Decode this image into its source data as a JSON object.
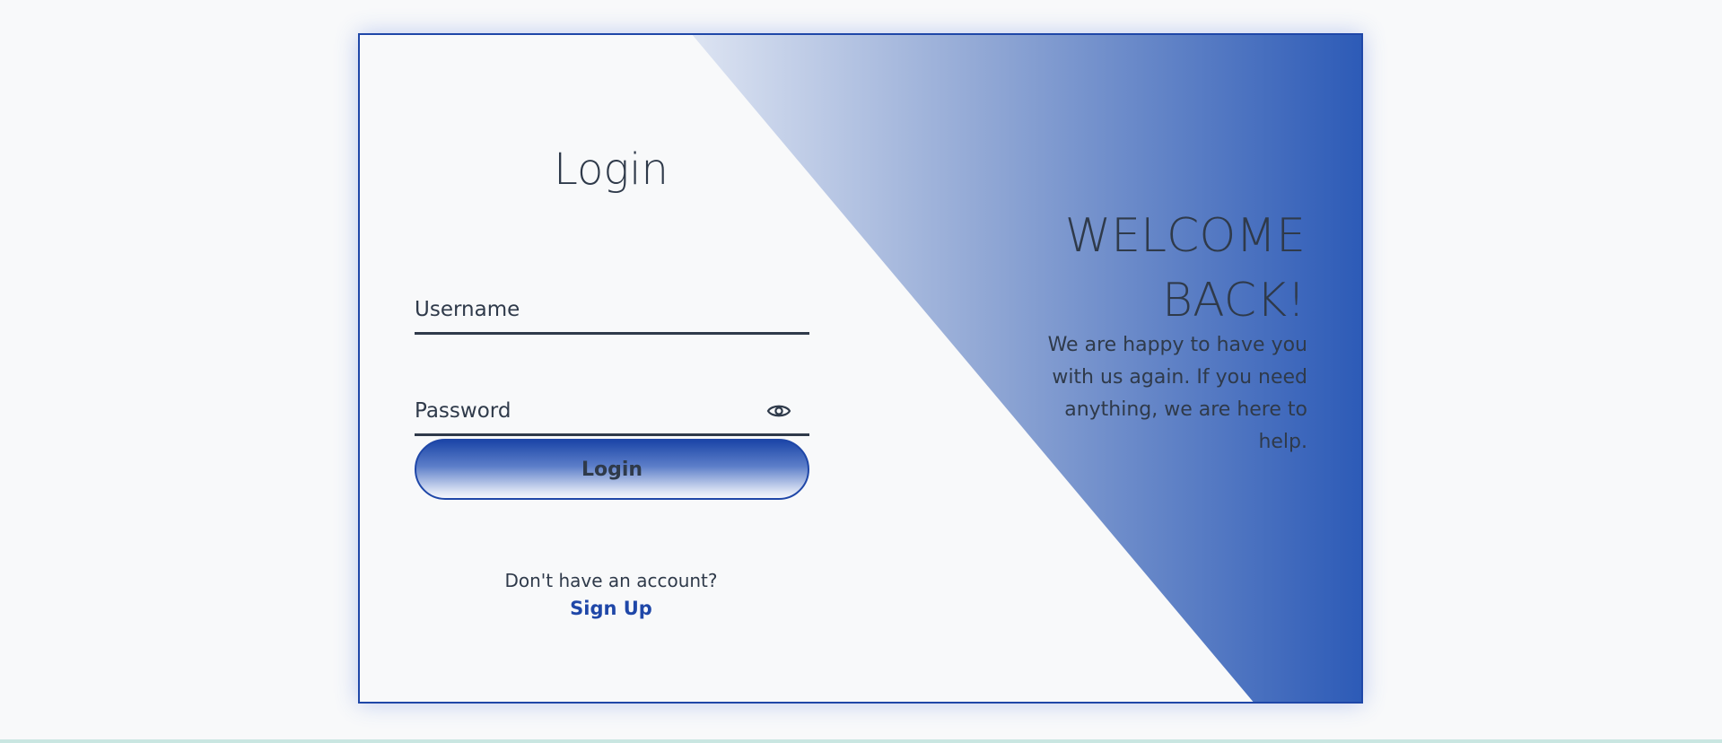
{
  "login_form": {
    "title": "Login",
    "username_placeholder": "Username",
    "password_placeholder": "Password",
    "submit_label": "Login",
    "signup_prompt": "Don't have an account?",
    "signup_link": "Sign Up"
  },
  "welcome_panel": {
    "heading": "WELCOME BACK!",
    "message": "We are happy to have you with us again. If you need anything, we are here to help."
  },
  "icons": {
    "password_toggle": "eye-icon"
  },
  "colors": {
    "accent": "#1f47a8",
    "gradient_end": "#2d5bb7",
    "text": "#2f3a4a",
    "background": "#f8f9fa"
  }
}
